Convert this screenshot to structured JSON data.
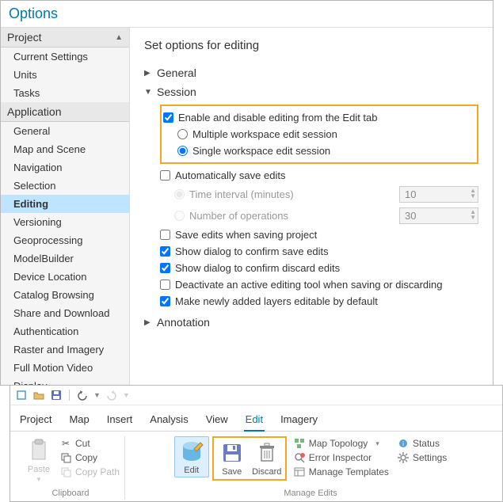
{
  "window": {
    "title": "Options"
  },
  "sidebar": {
    "sections": [
      {
        "header": "Project",
        "items": [
          "Current Settings",
          "Units",
          "Tasks"
        ]
      },
      {
        "header": "Application",
        "items": [
          "General",
          "Map and Scene",
          "Navigation",
          "Selection",
          "Editing",
          "Versioning",
          "Geoprocessing",
          "ModelBuilder",
          "Device Location",
          "Catalog Browsing",
          "Share and Download",
          "Authentication",
          "Raster and Imagery",
          "Full Motion Video",
          "Display"
        ]
      }
    ],
    "selected": "Editing"
  },
  "content": {
    "title": "Set options for editing",
    "groups": {
      "general": {
        "label": "General",
        "expanded": false
      },
      "session": {
        "label": "Session",
        "expanded": true,
        "enable_edit_tab": {
          "label": "Enable and disable editing from the Edit tab",
          "checked": true
        },
        "multi_ws": {
          "label": "Multiple workspace edit session",
          "checked": false
        },
        "single_ws": {
          "label": "Single workspace edit session",
          "checked": true
        },
        "auto_save": {
          "label": "Automatically save edits",
          "checked": false
        },
        "time_interval": {
          "label": "Time interval (minutes)",
          "value": "10",
          "checked": true
        },
        "num_ops": {
          "label": "Number of operations",
          "value": "30",
          "checked": false
        },
        "save_on_project": {
          "label": "Save edits when saving project",
          "checked": false
        },
        "confirm_save": {
          "label": "Show dialog to confirm save edits",
          "checked": true
        },
        "confirm_discard": {
          "label": "Show dialog to confirm discard edits",
          "checked": true
        },
        "deactivate_tool": {
          "label": "Deactivate an active editing tool when saving or discarding",
          "checked": false
        },
        "new_layers_editable": {
          "label": "Make newly added layers editable by default",
          "checked": true
        }
      },
      "annotation": {
        "label": "Annotation",
        "expanded": false
      }
    }
  },
  "ribbon": {
    "tabs": [
      "Project",
      "Map",
      "Insert",
      "Analysis",
      "View",
      "Edit",
      "Imagery"
    ],
    "active": "Edit",
    "clipboard": {
      "label": "Clipboard",
      "paste": "Paste",
      "cut": "Cut",
      "copy": "Copy",
      "copypath": "Copy Path"
    },
    "manage": {
      "label": "Manage Edits",
      "edit": "Edit",
      "save": "Save",
      "discard": "Discard",
      "map_topology": "Map Topology",
      "error_inspector": "Error Inspector",
      "manage_templates": "Manage Templates",
      "status": "Status",
      "settings": "Settings"
    }
  }
}
